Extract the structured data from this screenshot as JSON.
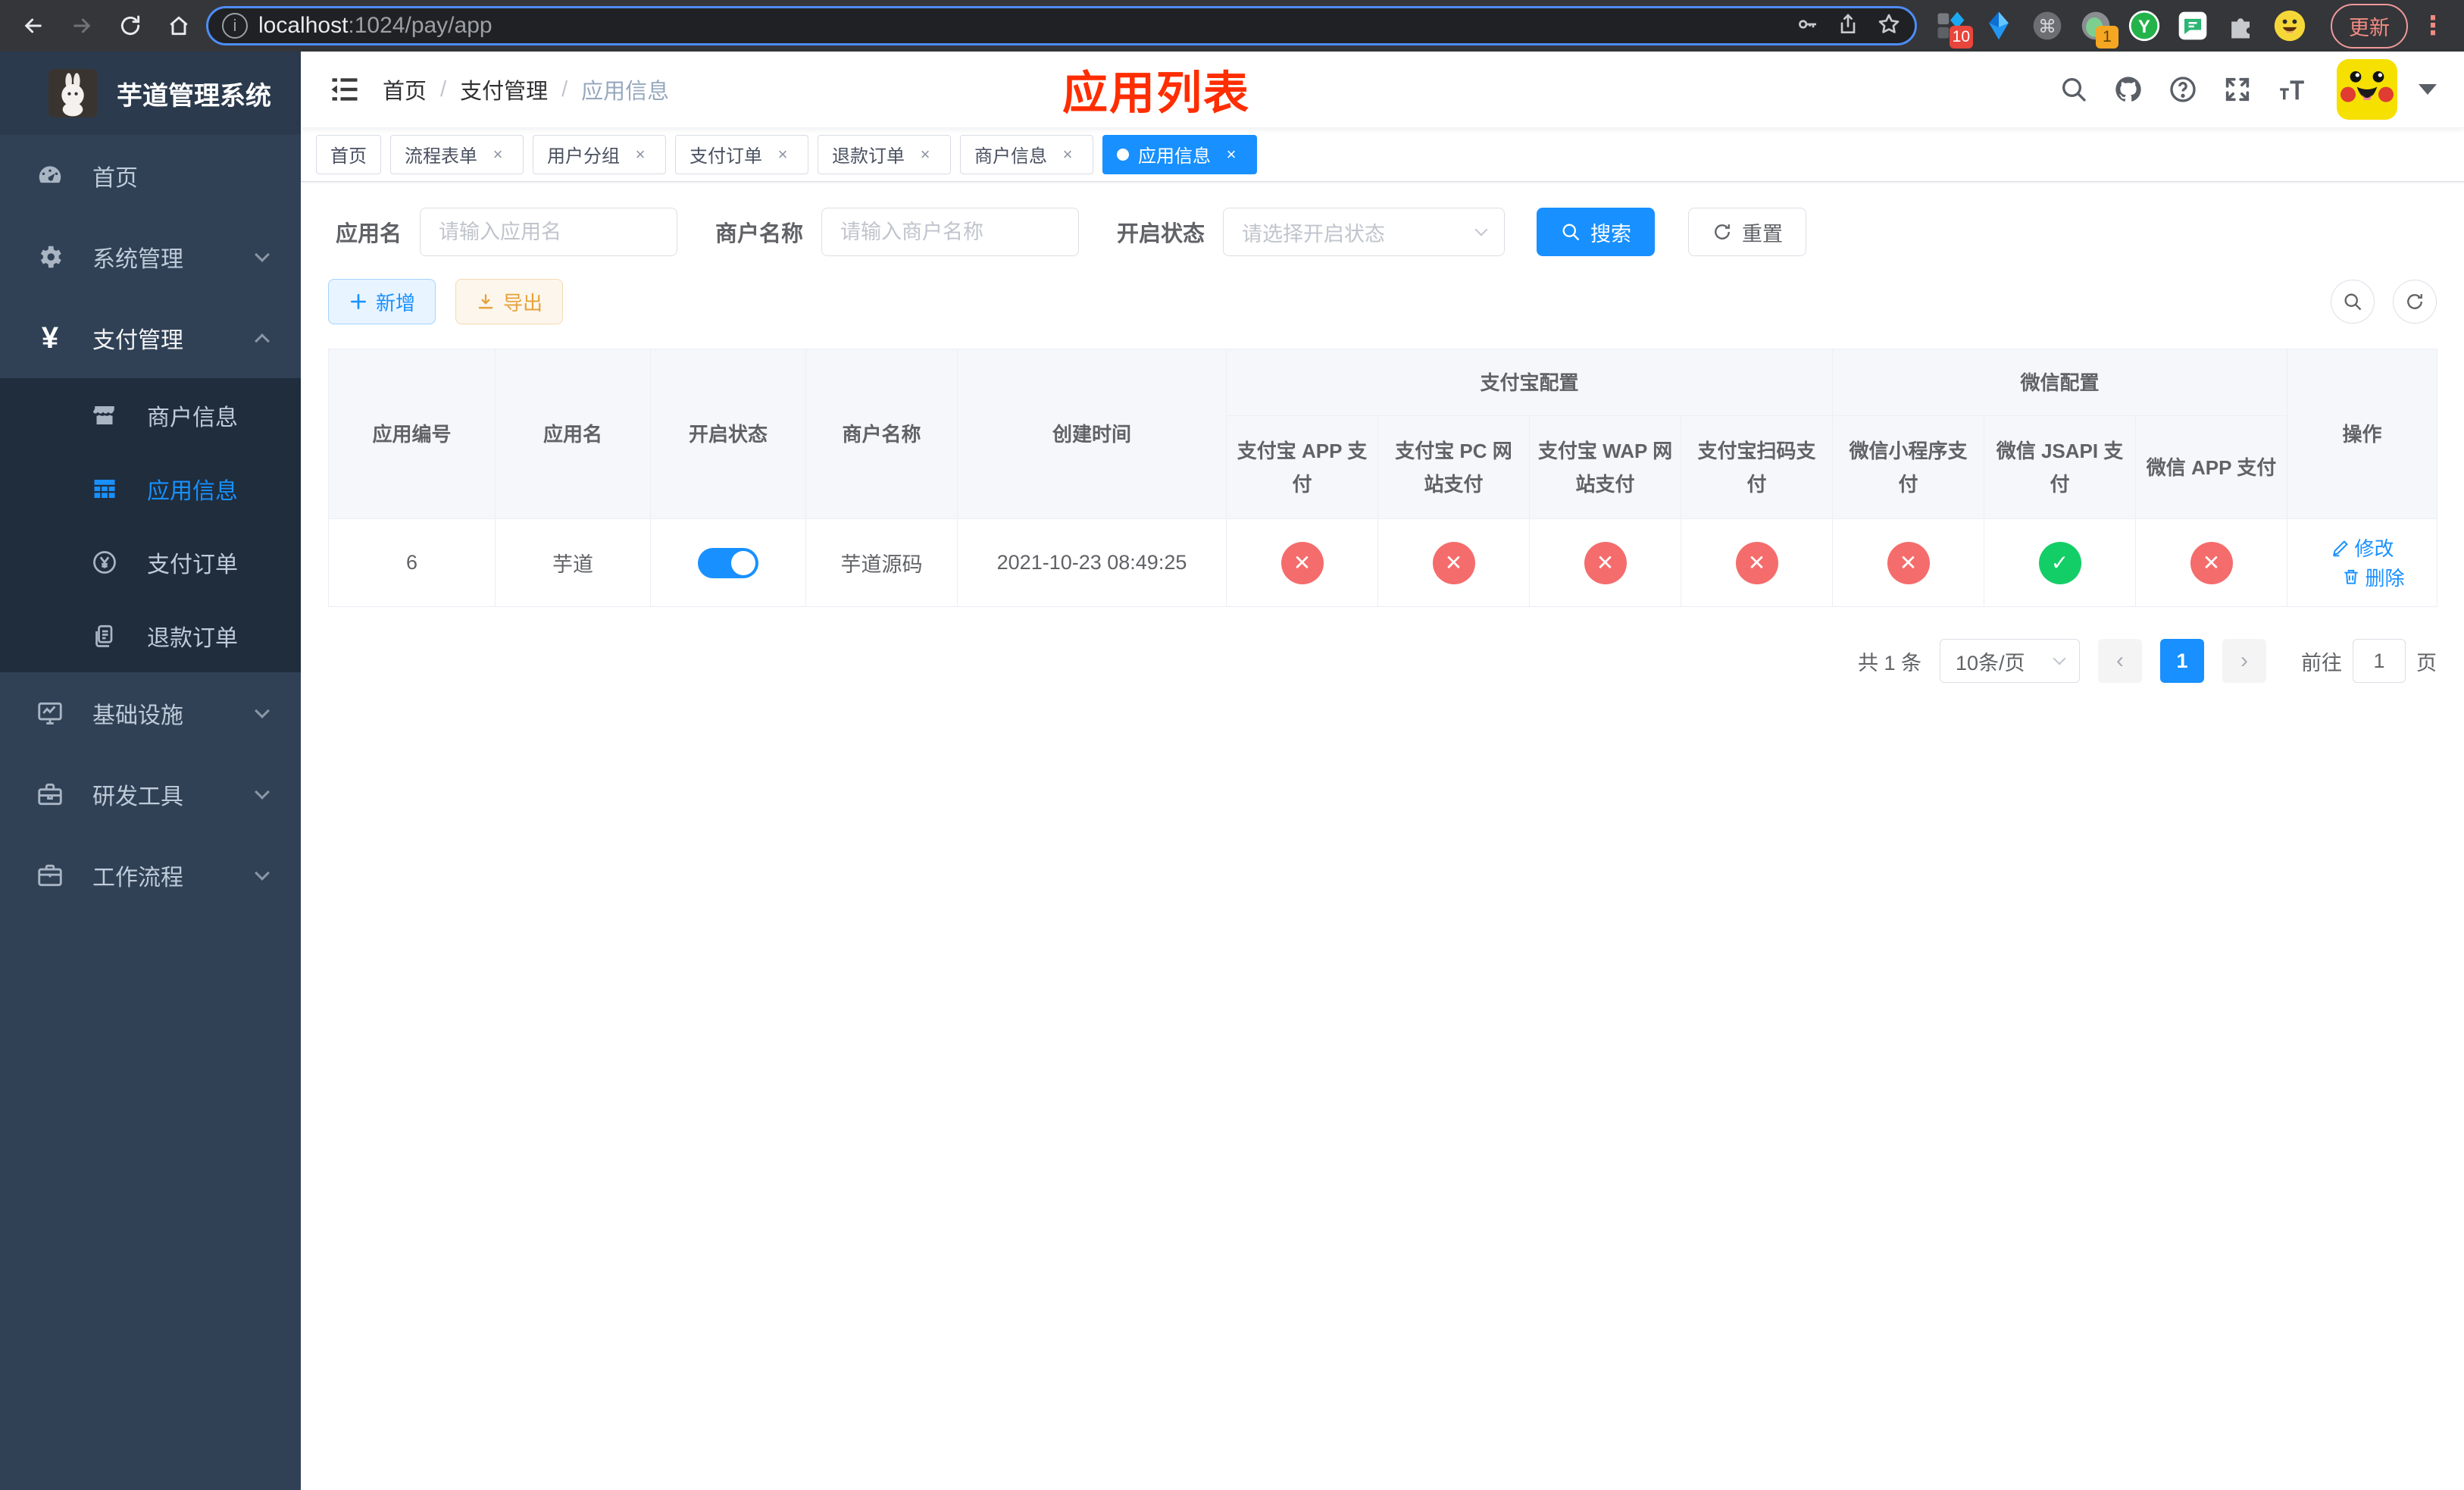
{
  "colors": {
    "theme": "#1890ff",
    "success": "#13ce66",
    "danger": "#f56c6c",
    "annotation": "#ff2d00"
  },
  "browser": {
    "url": {
      "host": "localhost",
      "rest": ":1024/pay/app"
    },
    "update_label": "更新",
    "extensions": {
      "grid_badge": "10",
      "circle_badge": "1",
      "y_label": "Y",
      "cmd_label": "⌘"
    }
  },
  "sidebar": {
    "title": "芋道管理系统",
    "items": [
      {
        "label": "首页"
      },
      {
        "label": "系统管理"
      },
      {
        "label": "支付管理"
      },
      {
        "label": "基础设施"
      },
      {
        "label": "研发工具"
      },
      {
        "label": "工作流程"
      }
    ],
    "pay_children": [
      {
        "label": "商户信息"
      },
      {
        "label": "应用信息"
      },
      {
        "label": "支付订单"
      },
      {
        "label": "退款订单"
      }
    ]
  },
  "header": {
    "breadcrumb": [
      "首页",
      "支付管理",
      "应用信息"
    ],
    "annotation": "应用列表"
  },
  "tabs": [
    {
      "label": "首页"
    },
    {
      "label": "流程表单"
    },
    {
      "label": "用户分组"
    },
    {
      "label": "支付订单"
    },
    {
      "label": "退款订单"
    },
    {
      "label": "商户信息"
    },
    {
      "label": "应用信息"
    }
  ],
  "filter": {
    "app_name_label": "应用名",
    "app_name_placeholder": "请输入应用名",
    "merchant_label": "商户名称",
    "merchant_placeholder": "请输入商户名称",
    "status_label": "开启状态",
    "status_placeholder": "请选择开启状态",
    "search_label": "搜索",
    "reset_label": "重置"
  },
  "toolbar": {
    "add_label": "新增",
    "export_label": "导出"
  },
  "table": {
    "headers": {
      "id": "应用编号",
      "name": "应用名",
      "enabled": "开启状态",
      "merchant": "商户名称",
      "created": "创建时间",
      "alipay_group": "支付宝配置",
      "wechat_group": "微信配置",
      "ops": "操作",
      "subs": [
        "支付宝 APP 支付",
        "支付宝 PC 网站支付",
        "支付宝 WAP 网站支付",
        "支付宝扫码支付",
        "微信小程序支付",
        "微信 JSAPI 支付",
        "微信 APP 支付"
      ]
    },
    "row": {
      "id": "6",
      "name": "芋道",
      "enabled": true,
      "merchant": "芋道源码",
      "created": "2021-10-23 08:49:25",
      "channels": [
        {
          "name": "alipay-app-pay",
          "enabled": false
        },
        {
          "name": "alipay-pc-pay",
          "enabled": false
        },
        {
          "name": "alipay-wap-pay",
          "enabled": false
        },
        {
          "name": "alipay-qr-pay",
          "enabled": false
        },
        {
          "name": "wechat-miniapp-pay",
          "enabled": false
        },
        {
          "name": "wechat-jsapi-pay",
          "enabled": true
        },
        {
          "name": "wechat-app-pay",
          "enabled": false
        }
      ],
      "edit_label": "修改",
      "delete_label": "删除"
    }
  },
  "pagination": {
    "total": "共 1 条",
    "page_size": "10条/页",
    "current": "1",
    "goto_label": "前往",
    "goto_value": "1",
    "unit_label": "页"
  }
}
